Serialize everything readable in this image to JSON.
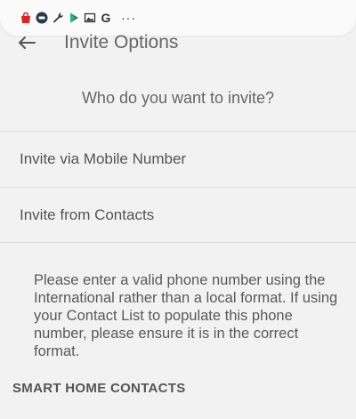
{
  "status_bar": {
    "icons": [
      "shopping-bag-icon",
      "tile-icon",
      "wrench-icon",
      "play-store-icon",
      "image-icon",
      "google-icon"
    ],
    "google_letter": "G",
    "more": "···"
  },
  "header": {
    "back_icon": "arrow-left-icon",
    "title": "Invite Options"
  },
  "prompt": "Who do you want to invite?",
  "options": [
    {
      "label": "Invite via Mobile Number"
    },
    {
      "label": "Invite from Contacts"
    }
  ],
  "info_text": "Please enter a valid phone number using the International rather than a local format. If using your Contact List to populate this phone number, please ensure it is in the correct format.",
  "section_header": "SMART HOME CONTACTS",
  "colors": {
    "background": "#f2f2f2",
    "divider": "#dcdcdc",
    "text": "#555555"
  }
}
